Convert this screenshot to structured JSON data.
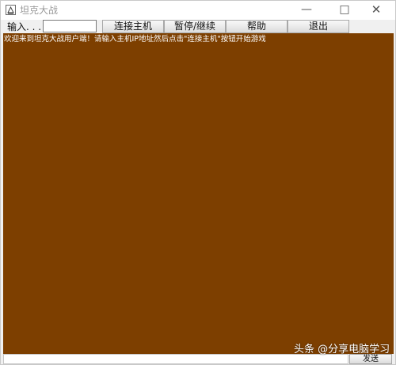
{
  "window": {
    "title": "坦克大战",
    "minimize_glyph": "—",
    "maximize_glyph": "□",
    "close_glyph": "✕",
    "app_icon": "java-app-icon"
  },
  "toolbar": {
    "input_label": "输入. . .",
    "ip_value": "",
    "connect_label": "连接主机",
    "pause_label": "暂停/继续",
    "help_label": "帮助",
    "exit_label": "退出"
  },
  "canvas": {
    "background": "#7d3f00",
    "welcome_text": "欢迎来到坦克大战用户端！请输入主机IP地址然后点击\"连接主机\"按钮开始游戏"
  },
  "bottom": {
    "message_value": "",
    "send_label": "发送"
  },
  "watermark": {
    "text": "头条 @分享电脑学习"
  }
}
